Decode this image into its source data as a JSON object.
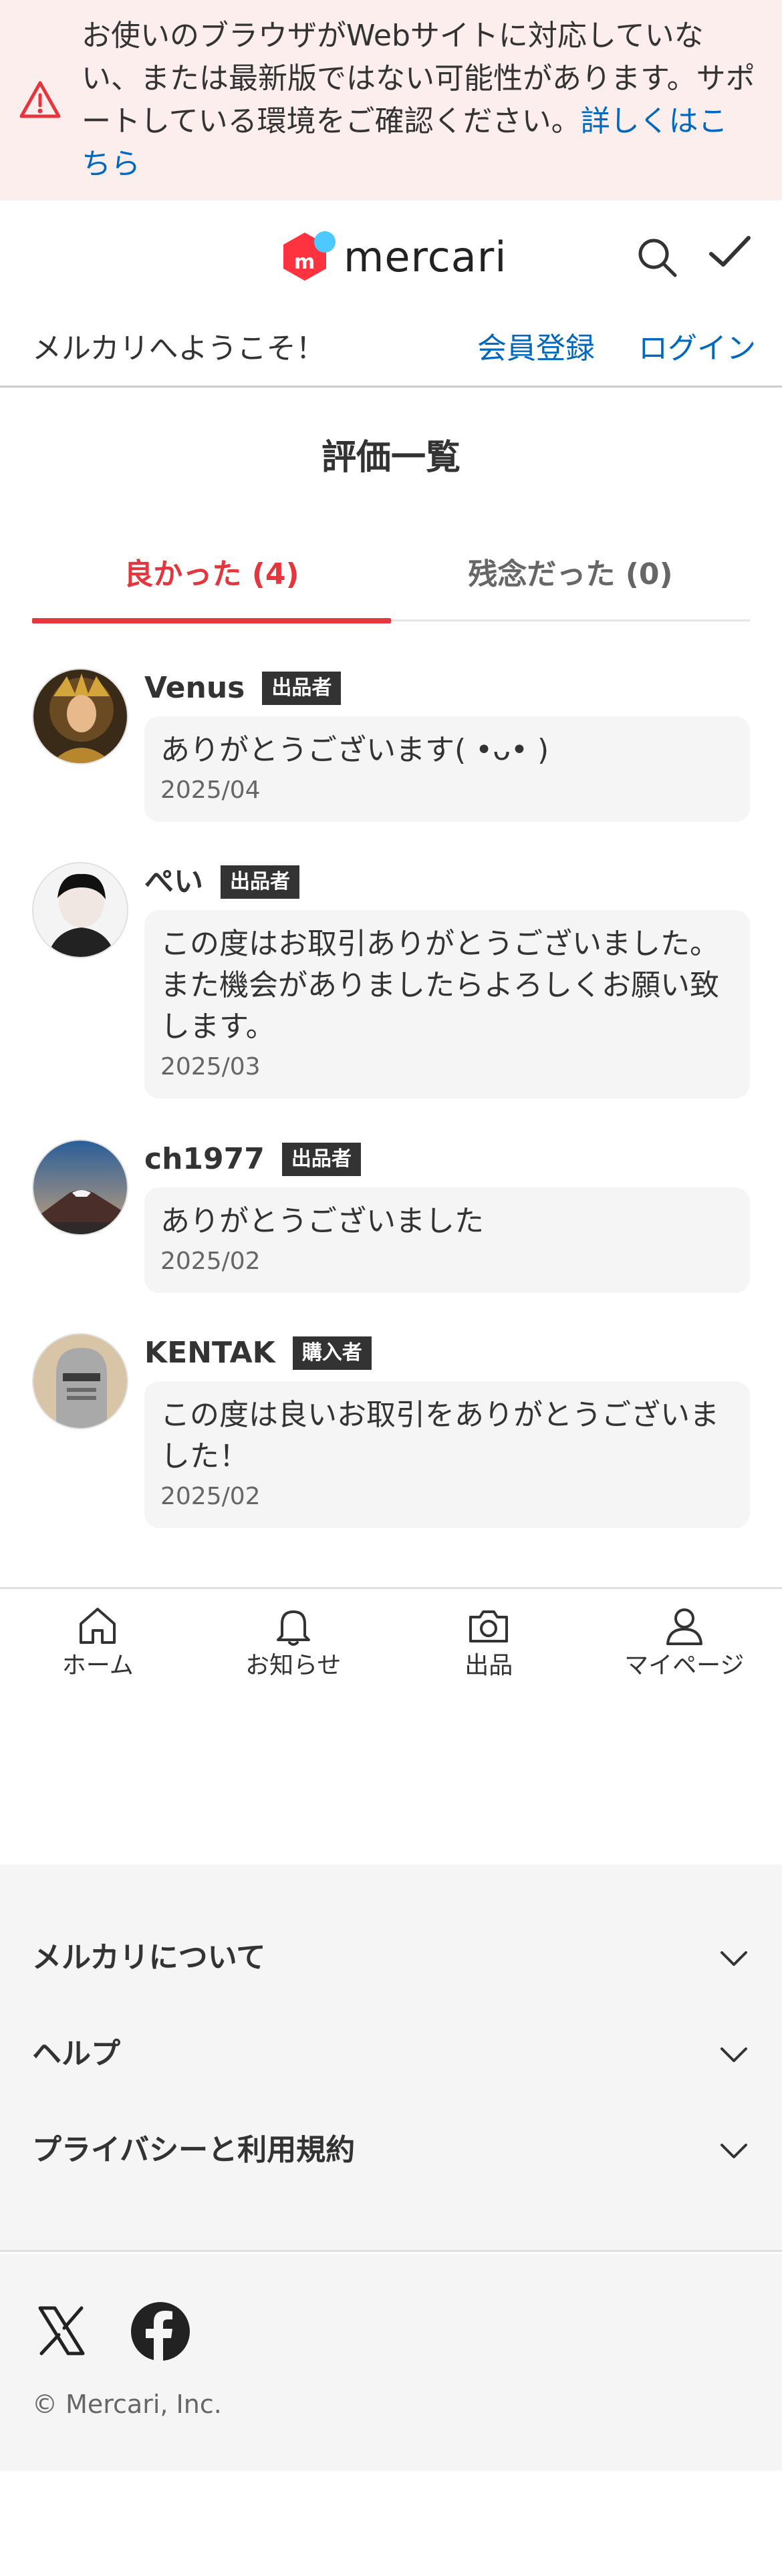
{
  "banner": {
    "message": "お使いのブラウザがWebサイトに対応していない、または最新版ではない可能性があります。サポートしている環境をご確認ください。",
    "link": "詳しくはこちら"
  },
  "header": {
    "logo_text": "mercari",
    "brand_color": "#ff333f",
    "link_color": "#0068bf"
  },
  "welcome": {
    "text": "メルカリへようこそ！",
    "signup": "会員登録",
    "login": "ログイン"
  },
  "page": {
    "title": "評価一覧"
  },
  "tabs": [
    {
      "label": "良かった (4)",
      "active": true
    },
    {
      "label": "残念だった (0)",
      "active": false
    }
  ],
  "reviews": [
    {
      "name": "Venus",
      "role": "出品者",
      "comment": "ありがとうございます( •ᴗ• )",
      "date": "2025/04"
    },
    {
      "name": "ぺい",
      "role": "出品者",
      "comment": "この度はお取引ありがとうございました。また機会がありましたらよろしくお願い致します。",
      "date": "2025/03"
    },
    {
      "name": "ch1977",
      "role": "出品者",
      "comment": "ありがとうございました",
      "date": "2025/02"
    },
    {
      "name": "KENTAK",
      "role": "購入者",
      "comment": "この度は良いお取引をありがとうございました！",
      "date": "2025/02"
    }
  ],
  "bottom_nav": [
    {
      "label": "ホーム",
      "icon": "home-icon"
    },
    {
      "label": "お知らせ",
      "icon": "bell-icon"
    },
    {
      "label": "出品",
      "icon": "camera-icon"
    },
    {
      "label": "マイページ",
      "icon": "person-icon"
    }
  ],
  "footer": {
    "sections": [
      {
        "label": "メルカリについて"
      },
      {
        "label": "ヘルプ"
      },
      {
        "label": "プライバシーと利用規約"
      }
    ],
    "social": [
      "x-icon",
      "facebook-icon"
    ],
    "copyright": "© Mercari, Inc."
  }
}
